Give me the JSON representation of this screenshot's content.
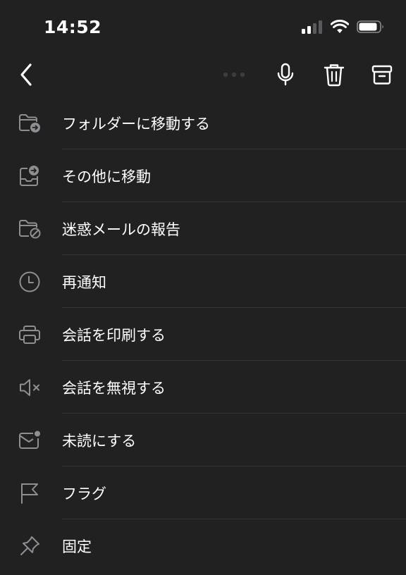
{
  "status_bar": {
    "time": "14:52",
    "icons": [
      "cellular-signal-icon",
      "wifi-icon",
      "battery-icon"
    ]
  },
  "toolbar": {
    "icons": [
      "back-chevron-icon",
      "more-dots-icon",
      "microphone-icon",
      "trash-icon",
      "archive-icon"
    ]
  },
  "menu": {
    "items": [
      {
        "label": "フォルダーに移動する",
        "icon": "folder-move-icon"
      },
      {
        "label": "その他に移動",
        "icon": "inbox-move-icon"
      },
      {
        "label": "迷惑メールの報告",
        "icon": "folder-block-icon"
      },
      {
        "label": "再通知",
        "icon": "clock-icon"
      },
      {
        "label": "会話を印刷する",
        "icon": "printer-icon"
      },
      {
        "label": "会話を無視する",
        "icon": "speaker-mute-icon"
      },
      {
        "label": "未読にする",
        "icon": "mail-unread-icon"
      },
      {
        "label": "フラグ",
        "icon": "flag-icon"
      },
      {
        "label": "固定",
        "icon": "pin-icon"
      }
    ]
  },
  "colors": {
    "background": "#212121",
    "text": "#ffffff",
    "icon": "#8e8e93",
    "separator": "#333335"
  }
}
